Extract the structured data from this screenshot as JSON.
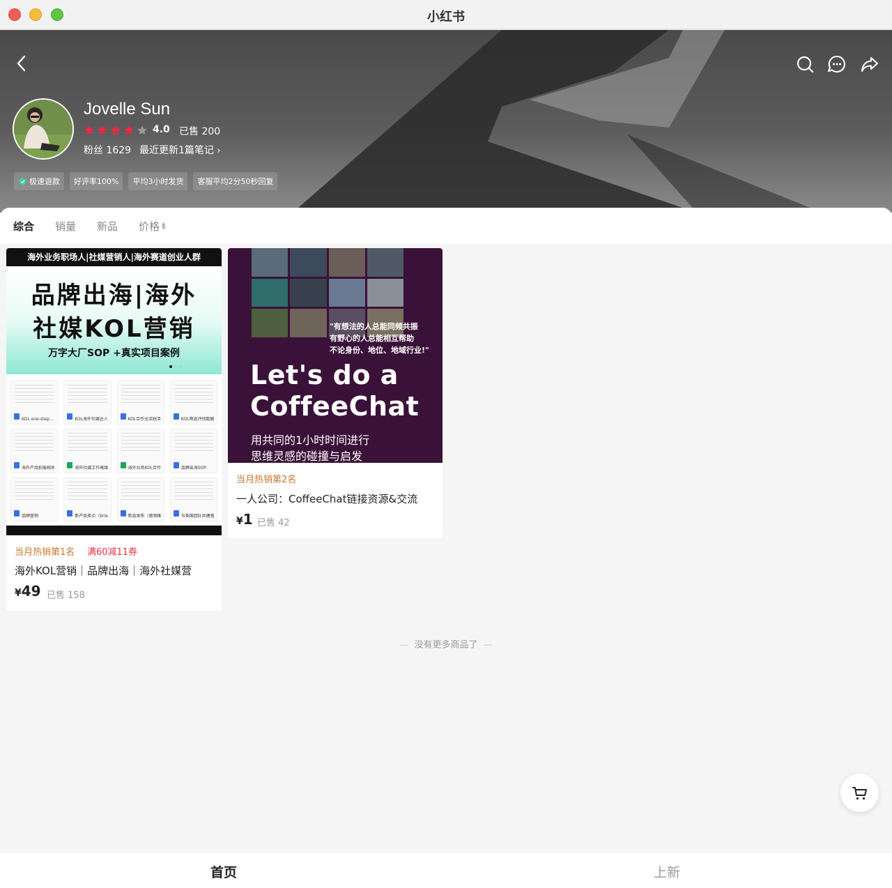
{
  "window": {
    "title": "小红书"
  },
  "shop": {
    "name": "Jovelle Sun",
    "rating": "4.0",
    "rating_stars": 4,
    "sold_total": "已售 200",
    "fans": "粉丝 1629",
    "recent_update": "最近更新1篇笔记",
    "badges": [
      "极速退款",
      "好评率100%",
      "平均3小时发货",
      "客服平均2分50秒回复"
    ]
  },
  "sort_tabs": [
    {
      "label": "综合",
      "active": true
    },
    {
      "label": "销量",
      "active": false
    },
    {
      "label": "新品",
      "active": false
    },
    {
      "label": "价格",
      "active": false
    }
  ],
  "products": [
    {
      "cover": {
        "banner": "海外业务职场人|社媒营销人|海外赛道创业人群",
        "headline_1": "品牌出海|海外",
        "headline_2": "社媒KOL营销",
        "subline": "万字大厂SOP +真实项目案例",
        "docs": [
          "KOL one-step...",
          "KOL海外社媒达人营销（...",
          "KOL合作全流程手册",
          "KOL筛选评估数据评估号...",
          "海外产品拍摄相关",
          "海外社媒工作高级词表",
          "海外业务KOL合作常用工...",
          "品牌出海SOP",
          "品牌营销",
          "新产品卖点（brief）框...",
          "新品发布（营销推广）整...",
          "与美国团队共建营销框架..."
        ]
      },
      "rank": "当月热销第1名",
      "coupon": "满60减11券",
      "title": "海外KOL营销｜品牌出海｜海外社媒营",
      "currency": "¥",
      "price": "49",
      "sold": "已售 158"
    },
    {
      "cover": {
        "quote_1": "\"有想法的人总能同频共振",
        "quote_2": "有野心的人总能相互帮助",
        "quote_3": "不论身份、地位、地域行业!\"",
        "big_1": "Let's do a",
        "big_2": "CoffeeChat",
        "sub_1": "用共同的1小时时间进行",
        "sub_2": "思维灵感的碰撞与启发"
      },
      "rank": "当月热销第2名",
      "title": "一人公司：CoffeeChat链接资源&交流",
      "currency": "¥",
      "price": "1",
      "sold": "已售 42"
    }
  ],
  "end_note": "没有更多商品了",
  "bottom_nav": {
    "home": "首页",
    "new": "上新"
  },
  "colors": {
    "accent": "#e8343f",
    "rank": "#c9752a",
    "star": "#ff2442",
    "coffee_bg": "#3a1138"
  },
  "icons": [
    "back-icon",
    "search-icon",
    "chat-icon",
    "share-icon",
    "star-icon",
    "shield-check-icon",
    "cart-icon",
    "sort-arrows-icon"
  ]
}
